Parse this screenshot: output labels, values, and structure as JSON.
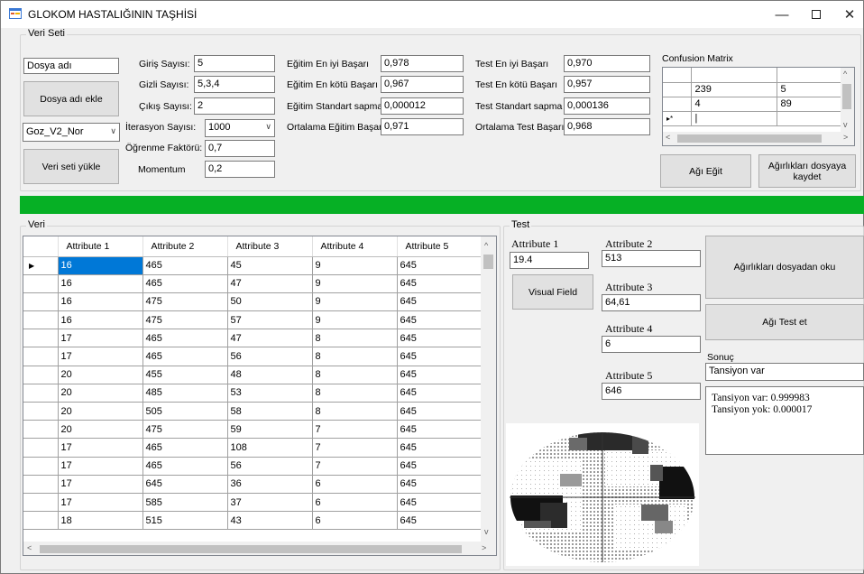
{
  "window": {
    "title": "GLOKOM HASTALIĞININ TAŞHİSİ"
  },
  "veri_seti": {
    "group_title": "Veri Seti",
    "dosya_adi_value": "Dosya adı",
    "dosya_adi_ekle_label": "Dosya adı ekle",
    "combo_value": "Goz_V2_Nor",
    "veri_seti_yukle_label": "Veri seti yükle",
    "giris_label": "Giriş Sayısı:",
    "giris_value": "5",
    "gizli_label": "Gizli Sayısı:",
    "gizli_value": "5,3,4",
    "cikis_label": "Çıkış Sayısı:",
    "cikis_value": "2",
    "iterasyon_label": "İterasyon Sayısı:",
    "iterasyon_value": "1000",
    "ogrenme_label": "Öğrenme Faktörü:",
    "ogrenme_value": "0,7",
    "momentum_label": "Momentum",
    "momentum_value": "0,2",
    "egitim_en_iyi_label": "Eğitim En iyi Başarı",
    "egitim_en_iyi_value": "0,978",
    "egitim_en_kotu_label": "Eğitim En kötü Başarı",
    "egitim_en_kotu_value": "0,967",
    "egitim_std_label": "Eğitim Standart sapma",
    "egitim_std_value": "0,000012",
    "ort_egitim_label": "Ortalama Eğitim Başarı",
    "ort_egitim_value": "0,971",
    "test_en_iyi_label": "Test En iyi Başarı",
    "test_en_iyi_value": "0,970",
    "test_en_kotu_label": "Test En kötü Başarı",
    "test_en_kotu_value": "0,957",
    "test_std_label": "Test Standart sapma",
    "test_std_value": "0,000136",
    "ort_test_label": "Ortalama Test Başarı",
    "ort_test_value": "0,968",
    "confusion_label": "Confusion Matrix",
    "confusion_rows": [
      [
        "",
        "",
        ""
      ],
      [
        "",
        "239",
        "5"
      ],
      [
        "",
        "4",
        "89"
      ],
      [
        "▸*",
        "|",
        ""
      ]
    ],
    "agi_egit_label": "Ağı Eğit",
    "agirliklari_kaydet_label": "Ağırlıkları dosyaya kaydet"
  },
  "progress": {
    "value": 1.0,
    "color": "#06b025"
  },
  "veri": {
    "group_title": "Veri",
    "columns": [
      "Attribute 1",
      "Attribute 2",
      "Attribute 3",
      "Attribute 4",
      "Attribute 5"
    ],
    "rows": [
      [
        "16",
        "465",
        "45",
        "9",
        "645"
      ],
      [
        "16",
        "465",
        "47",
        "9",
        "645"
      ],
      [
        "16",
        "475",
        "50",
        "9",
        "645"
      ],
      [
        "16",
        "475",
        "57",
        "9",
        "645"
      ],
      [
        "17",
        "465",
        "47",
        "8",
        "645"
      ],
      [
        "17",
        "465",
        "56",
        "8",
        "645"
      ],
      [
        "20",
        "455",
        "48",
        "8",
        "645"
      ],
      [
        "20",
        "485",
        "53",
        "8",
        "645"
      ],
      [
        "20",
        "505",
        "58",
        "8",
        "645"
      ],
      [
        "20",
        "475",
        "59",
        "7",
        "645"
      ],
      [
        "17",
        "465",
        "108",
        "7",
        "645"
      ],
      [
        "17",
        "465",
        "56",
        "7",
        "645"
      ],
      [
        "17",
        "645",
        "36",
        "6",
        "645"
      ],
      [
        "17",
        "585",
        "37",
        "6",
        "645"
      ],
      [
        "18",
        "515",
        "43",
        "6",
        "645"
      ]
    ]
  },
  "test": {
    "group_title": "Test",
    "attr1_label": "Attribute 1",
    "attr1_value": "19.4",
    "attr2_label": "Attribute 2",
    "attr2_value": "513",
    "attr3_label": "Attribute 3",
    "attr3_value": "64,61",
    "attr4_label": "Attribute 4",
    "attr4_value": "6",
    "attr5_label": "Attribute 5",
    "attr5_value": "646",
    "visual_field_label": "Visual Field",
    "agirliklari_oku_label": "Ağırlıkları dosyadan oku",
    "agi_test_label": "Ağı Test et",
    "sonuc_label": "Sonuç",
    "sonuc_value": "Tansiyon var",
    "result_line1": "Tansiyon var:  0.999983",
    "result_line2": "Tansiyon yok: 0.000017"
  }
}
